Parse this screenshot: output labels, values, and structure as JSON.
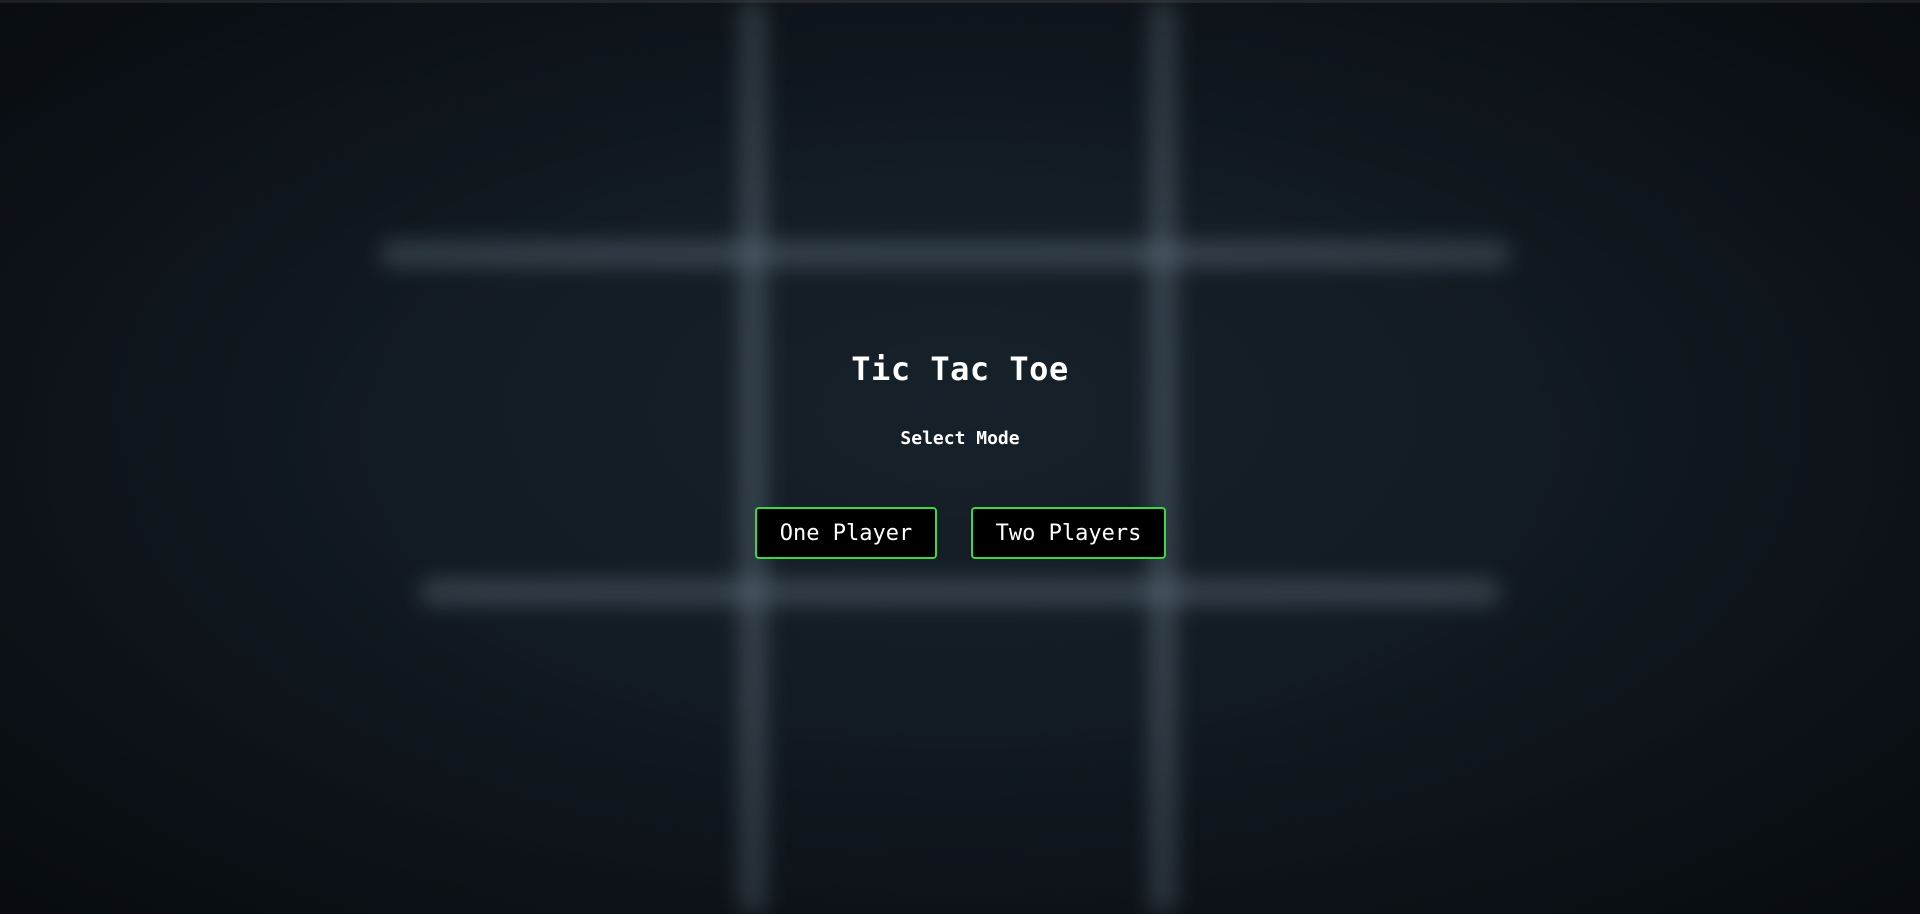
{
  "game": {
    "title": "Tic Tac Toe",
    "subtitle": "Select Mode"
  },
  "buttons": {
    "one_player": "One Player",
    "two_players": "Two Players"
  },
  "colors": {
    "background": "#121a22",
    "button_border": "#3fd63f",
    "button_fill": "#000000",
    "text": "#ffffff"
  }
}
